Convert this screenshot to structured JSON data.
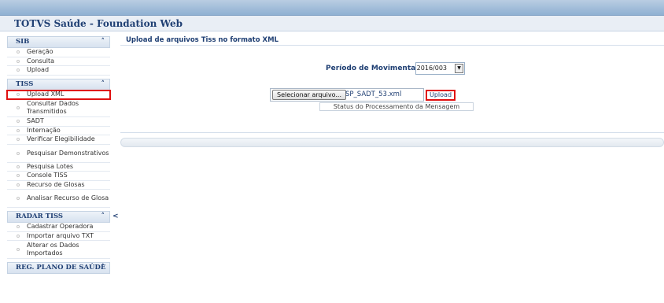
{
  "app": {
    "title": "TOTVS Saúde - Foundation Web"
  },
  "sidebar": {
    "sections": [
      {
        "title": "SIB",
        "items": [
          "Geração",
          "Consulta",
          "Upload"
        ]
      },
      {
        "title": "TISS",
        "items": [
          "Upload XML",
          "Consultar Dados Transmitidos",
          "SADT",
          "Internação",
          "Verificar Elegibilidade",
          "Pesquisar Demonstrativos",
          "Pesquisa Lotes",
          "Console TISS",
          "Recurso de Glosas",
          "Analisar Recurso de Glosa"
        ]
      },
      {
        "title": "RADAR TISS",
        "items": [
          "Cadastrar Operadora",
          "Importar arquivo TXT",
          "Alterar os Dados Importados"
        ]
      },
      {
        "title": "REG. PLANO DE SAÚDE",
        "items": []
      }
    ],
    "selected": "Upload XML",
    "collapse_glyph": "<"
  },
  "content": {
    "title": "Upload de arquivos Tiss no formato XML",
    "periodo_label": "Período de Movimentação:",
    "periodo_value": "2016/003",
    "file_button": "Selecionar arquivo...",
    "file_name": "SP_SADT_53.xml",
    "upload_button": "Upload",
    "status_text": "Status do Processamento da Mensagem"
  }
}
